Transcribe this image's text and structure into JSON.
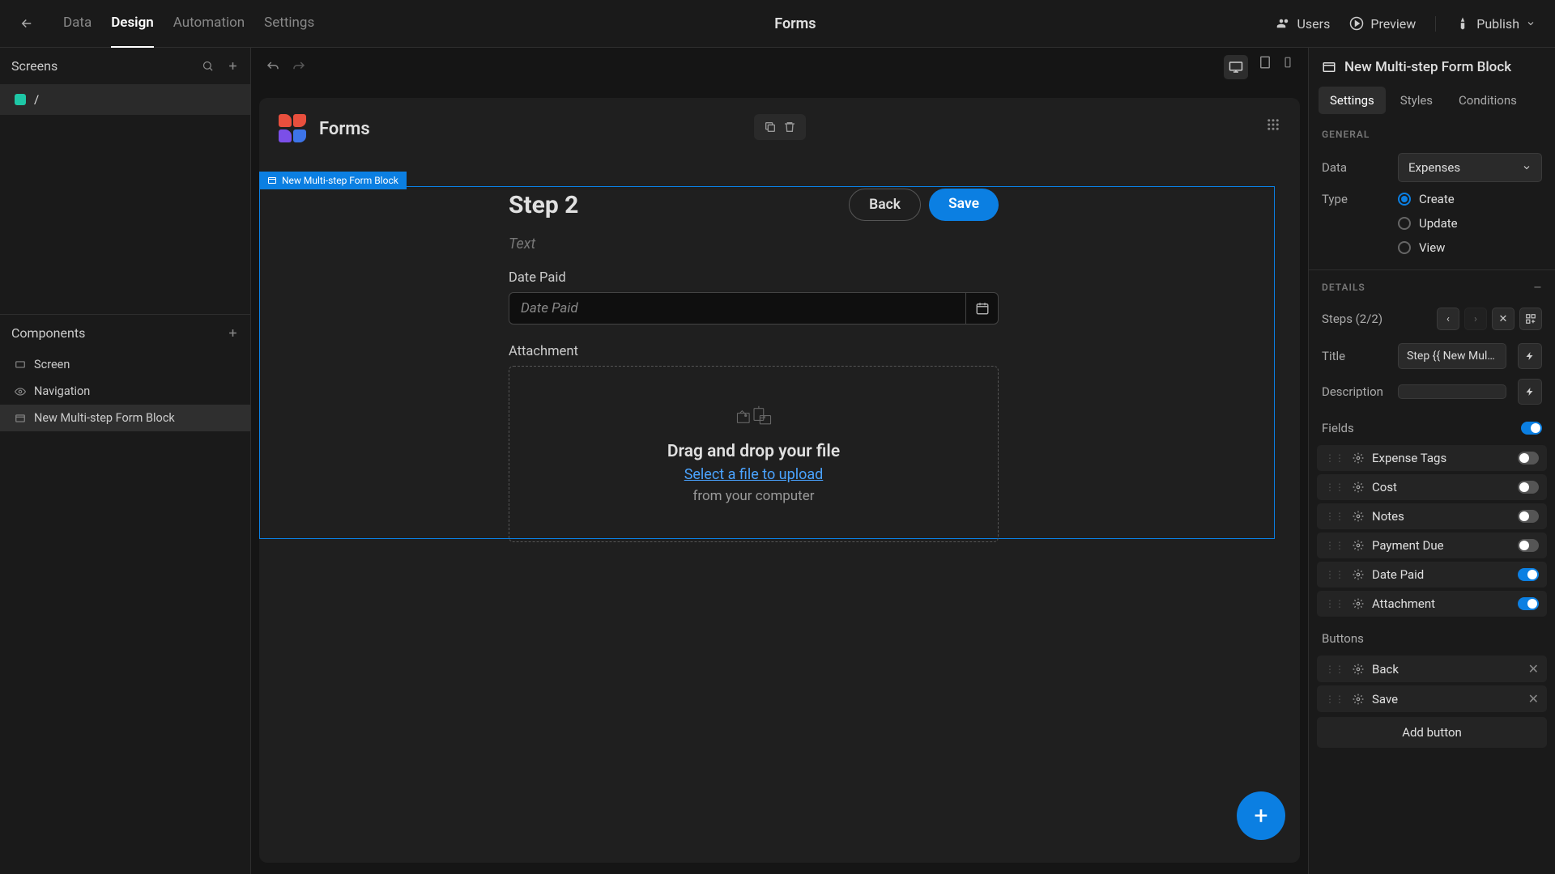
{
  "topbar": {
    "tabs": [
      "Data",
      "Design",
      "Automation",
      "Settings"
    ],
    "active_tab": 1,
    "title": "Forms",
    "users": "Users",
    "preview": "Preview",
    "publish": "Publish"
  },
  "left": {
    "screens_label": "Screens",
    "screen_name": "/",
    "components_label": "Components",
    "tree": {
      "screen": "Screen",
      "navigation": "Navigation",
      "block": "New Multi-step Form Block"
    }
  },
  "canvas": {
    "app_title": "Forms",
    "block_tag": "New Multi-step Form Block",
    "step_title": "Step 2",
    "back_btn": "Back",
    "save_btn": "Save",
    "desc_placeholder": "Text",
    "date_label": "Date Paid",
    "date_placeholder": "Date Paid",
    "attach_label": "Attachment",
    "dz_title": "Drag and drop your file",
    "dz_link": "Select a file to upload",
    "dz_sub": "from your computer"
  },
  "right": {
    "header": "New Multi-step Form Block",
    "tabs": [
      "Settings",
      "Styles",
      "Conditions"
    ],
    "general_label": "GENERAL",
    "data_label": "Data",
    "data_value": "Expenses",
    "type_label": "Type",
    "type_options": [
      "Create",
      "Update",
      "View"
    ],
    "type_selected": 0,
    "details_label": "DETAILS",
    "steps_label": "Steps (2/2)",
    "title_label": "Title",
    "title_value": "Step {{ New Multi-s…",
    "desc_label": "Description",
    "desc_value": "",
    "fields_label": "Fields",
    "fields": [
      {
        "name": "Expense Tags",
        "on": false
      },
      {
        "name": "Cost",
        "on": false
      },
      {
        "name": "Notes",
        "on": false
      },
      {
        "name": "Payment Due",
        "on": false
      },
      {
        "name": "Date Paid",
        "on": true
      },
      {
        "name": "Attachment",
        "on": true
      }
    ],
    "buttons_label": "Buttons",
    "buttons": [
      "Back",
      "Save"
    ],
    "add_button": "Add button"
  }
}
